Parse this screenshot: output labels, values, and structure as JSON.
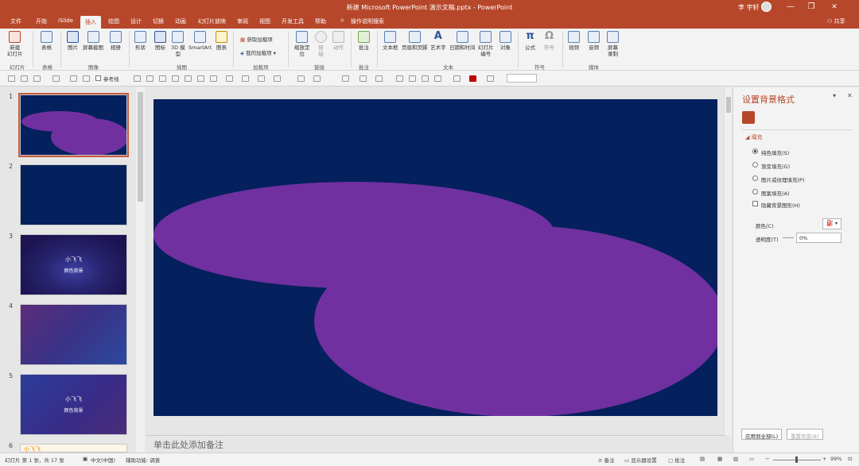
{
  "window": {
    "title": "新建 Microsoft PowerPoint 演示文稿.pptx  -  PowerPoint",
    "user": "李 宇轩",
    "minimize": "—",
    "restore": "❐",
    "close": "✕"
  },
  "tabs": [
    {
      "label": "文件",
      "active": false
    },
    {
      "label": "开始",
      "active": false
    },
    {
      "label": "iSlide",
      "active": false
    },
    {
      "label": "插入",
      "active": true
    },
    {
      "label": "绘图",
      "active": false
    },
    {
      "label": "设计",
      "active": false
    },
    {
      "label": "切换",
      "active": false
    },
    {
      "label": "动画",
      "active": false
    },
    {
      "label": "幻灯片放映",
      "active": false
    },
    {
      "label": "审阅",
      "active": false
    },
    {
      "label": "视图",
      "active": false
    },
    {
      "label": "开发工具",
      "active": false
    },
    {
      "label": "帮助",
      "active": false
    },
    {
      "label": "操作说明搜索",
      "active": false
    }
  ],
  "share_label": "共享",
  "ribbon": {
    "new_slide": "新建\n幻灯片",
    "table": "表格",
    "picture": "图片",
    "screenshot": "屏幕截图",
    "album": "相册",
    "shapes": "形状",
    "icons": "图标",
    "models3d": "3D 模\n型",
    "smartart": "SmartArt",
    "chart": "图表",
    "get_addins": "获取加载项",
    "my_addins": "我的加载项",
    "zoom": "缩放定\n位",
    "link": "链\n接",
    "action": "动作",
    "comment": "批注",
    "textbox": "文本框",
    "header_footer": "页眉和页脚",
    "wordart": "艺术字",
    "datetime": "日期和时间",
    "slide_number": "幻灯片\n编号",
    "object": "对象",
    "equation": "公式",
    "symbol": "符号",
    "video": "视频",
    "audio": "音频",
    "screen_record": "屏幕\n录制",
    "groups": {
      "slides": "幻灯片",
      "tables": "表格",
      "images": "图像",
      "illustrations": "插图",
      "addins": "加载项",
      "links": "链接",
      "comments": "批注",
      "text": "文本",
      "symbols": "符号",
      "media": "媒体"
    }
  },
  "quickbar": {
    "guides_label": "参考线"
  },
  "thumbnails": [
    {
      "num": "1",
      "selected": true
    },
    {
      "num": "2",
      "selected": false
    },
    {
      "num": "3",
      "selected": false,
      "line1": "小飞飞",
      "line2": "颜色背景"
    },
    {
      "num": "4",
      "selected": false
    },
    {
      "num": "5",
      "selected": false,
      "line1": "小飞飞",
      "line2": "颜色背景"
    },
    {
      "num": "6",
      "selected": false,
      "line1": "小飞飞"
    }
  ],
  "notes_placeholder": "单击此处添加备注",
  "format_pane": {
    "title": "设置背景格式",
    "close": "✕",
    "pin": "▾",
    "section": "填充",
    "options": [
      {
        "label": "纯色填充(S)",
        "type": "radio",
        "checked": true
      },
      {
        "label": "渐变填充(G)",
        "type": "radio",
        "checked": false
      },
      {
        "label": "图片或纹理填充(P)",
        "type": "radio",
        "checked": false
      },
      {
        "label": "图案填充(A)",
        "type": "radio",
        "checked": false
      },
      {
        "label": "隐藏背景图形(H)",
        "type": "checkbox",
        "checked": false
      }
    ],
    "color_label": "颜色(C)",
    "transparency_label": "透明度(T)",
    "transparency_value": "0%",
    "apply_all": "应用到全部(L)",
    "reset": "重置背景(B)"
  },
  "status": {
    "slide_info": "幻灯片 第 1 张，共 17 张",
    "language": "中文(中国)",
    "accessibility": "辅助功能: 调查",
    "notes": "备注",
    "display_settings": "显示器设置",
    "comments": "批注",
    "zoom": "99%"
  },
  "colors": {
    "accent": "#b7472a",
    "slide_bg": "#04205d",
    "shape_fill": "#7030a0"
  }
}
